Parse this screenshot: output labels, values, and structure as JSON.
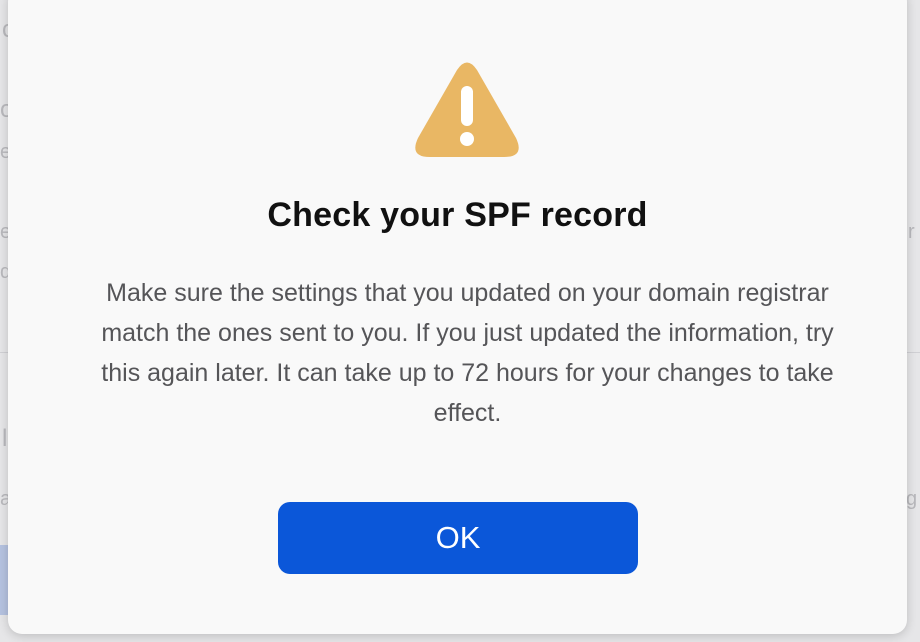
{
  "background_fragments": {
    "frag1": "c",
    "frag2": "o",
    "frag3": "e",
    "frag4": "e",
    "frag5": "d",
    "frag6": "r",
    "frag7": "l",
    "frag8": "a",
    "frag9": "g"
  },
  "dialog": {
    "icon": "warning-triangle-icon",
    "icon_color": "#e9b764",
    "title": "Check your SPF record",
    "message": "Make sure the settings that you updated on your domain registrar match the ones sent to you. If you just updated the information, try this again later. It can take up to 72 hours for your changes to take effect.",
    "ok_label": "OK",
    "button_color": "#0b57d9"
  }
}
